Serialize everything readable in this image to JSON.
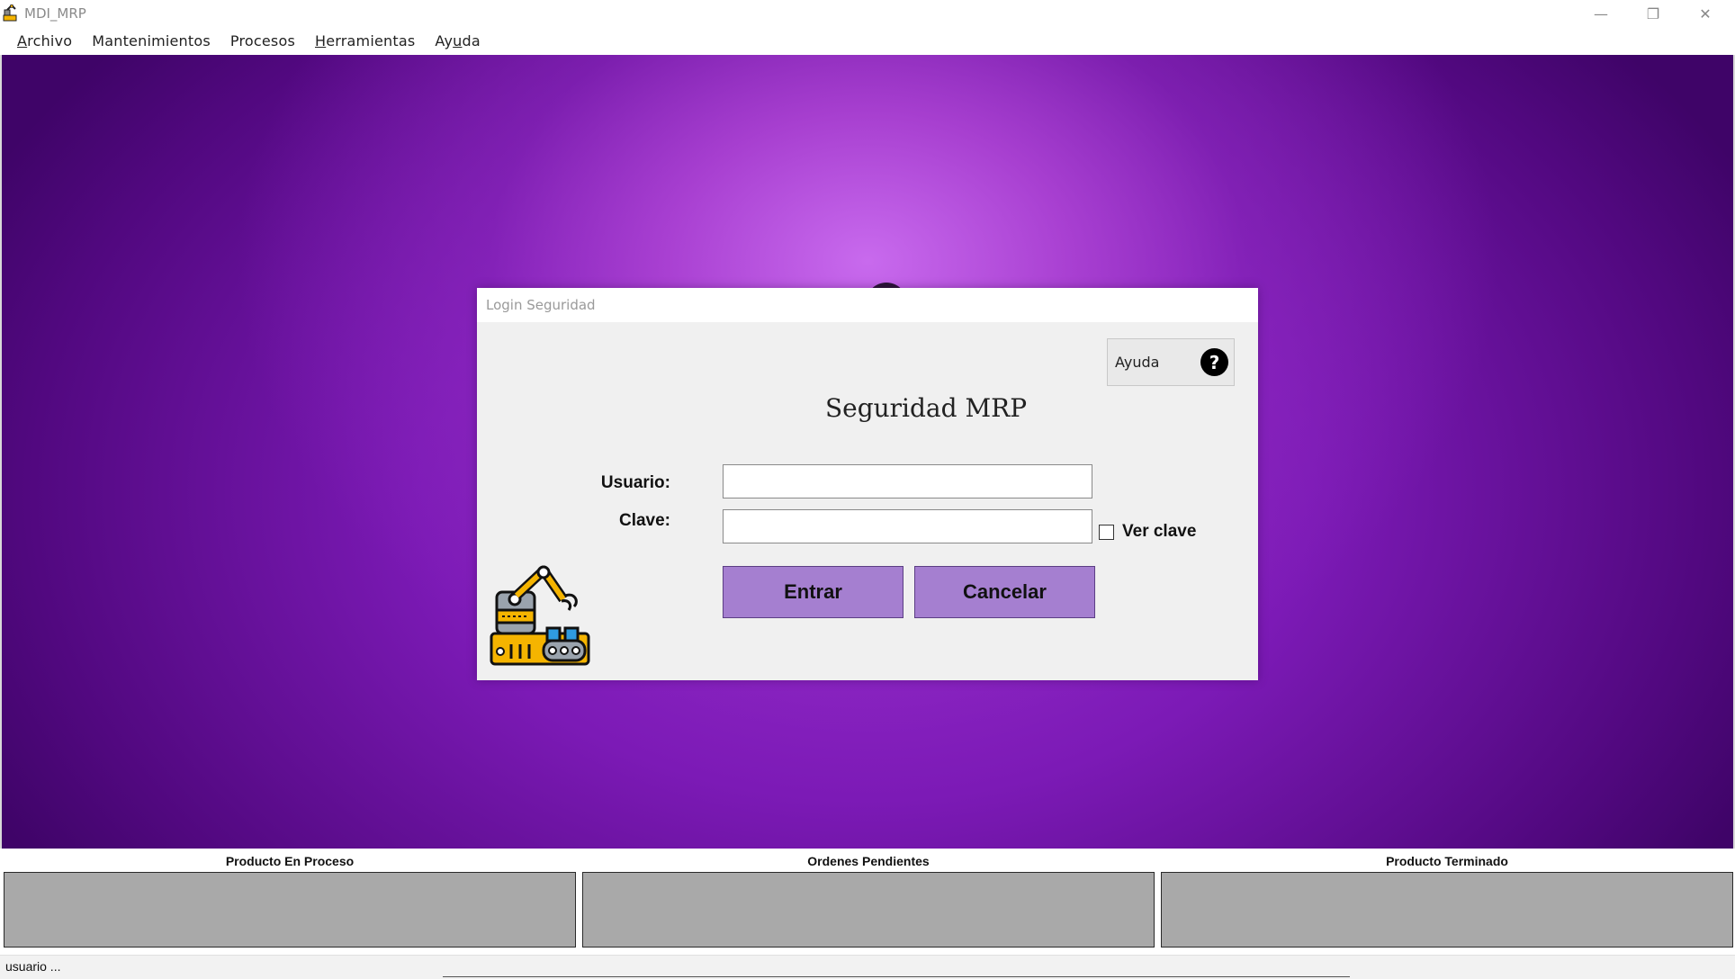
{
  "window": {
    "title": "MDI_MRP",
    "minimize_symbol": "—",
    "maximize_symbol": "❐",
    "close_symbol": "✕"
  },
  "menu": [
    {
      "label": "Archivo",
      "mnemonic": "A",
      "rest": "rchivo"
    },
    {
      "label": "Mantenimientos"
    },
    {
      "label": "Procesos"
    },
    {
      "label": "Herramientas",
      "mnemonic": "H",
      "rest": "erramientas"
    },
    {
      "label": "Ayuda",
      "pre": "Ay",
      "mnemonic": "u",
      "rest": "da"
    }
  ],
  "dialog": {
    "title": "Login Seguridad",
    "help_label": "Ayuda",
    "help_icon": "?",
    "heading": "Seguridad MRP",
    "user_label": "Usuario:",
    "user_value": "",
    "password_label": "Clave:",
    "password_value": "",
    "show_password_label": "Ver clave",
    "enter_label": "Entrar",
    "cancel_label": "Cancelar"
  },
  "panels": [
    {
      "title": "Producto En Proceso"
    },
    {
      "title": "Ordenes Pendientes"
    },
    {
      "title": "Producto Terminado"
    }
  ],
  "status": {
    "text": "usuario  ..."
  },
  "colors": {
    "button_fill": "#a57fd0",
    "mdi_center": "#cc6ef0",
    "mdi_edge": "#3f0468",
    "panel_fill": "#a9a9a9"
  }
}
